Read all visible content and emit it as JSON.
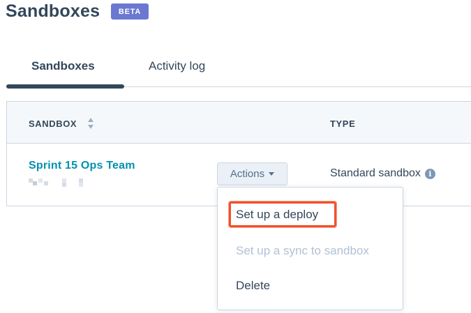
{
  "page": {
    "title": "Sandboxes",
    "badge": "BETA"
  },
  "tabs": [
    {
      "label": "Sandboxes",
      "active": true
    },
    {
      "label": "Activity log",
      "active": false
    }
  ],
  "table": {
    "columns": [
      "SANDBOX",
      "TYPE"
    ],
    "rows": [
      {
        "name": "Sprint 15 Ops Team",
        "actions_label": "Actions",
        "type": "Standard sandbox"
      }
    ]
  },
  "actions_menu": {
    "items": [
      {
        "label": "Set up a deploy",
        "disabled": false,
        "highlighted": true
      },
      {
        "label": "Set up a sync to sandbox",
        "disabled": true
      },
      {
        "label": "Delete",
        "disabled": false
      }
    ]
  },
  "colors": {
    "primary_text": "#33475b",
    "link": "#0091ae",
    "badge_bg": "#6a78d1",
    "highlight": "#f0512d",
    "disabled_text": "#b0c1d4"
  },
  "icons": [
    "sort-icon",
    "caret-down-icon",
    "info-icon"
  ]
}
